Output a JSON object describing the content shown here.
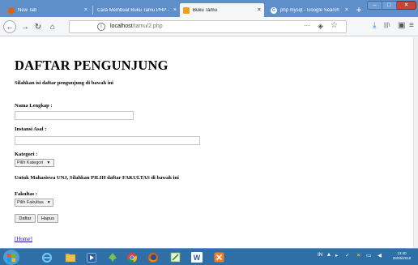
{
  "browser": {
    "tabs": [
      {
        "label": "New Tab",
        "icon": "firefox-icon",
        "color": "#e66000"
      },
      {
        "label": "Cara Membuat Buku Tamu PHP - S",
        "icon": "page-icon",
        "color": "#ffffff"
      },
      {
        "label": "Buku Tamu",
        "icon": "buku-tamu-icon",
        "color": "#f0a020"
      },
      {
        "label": "php mysql - Google Search",
        "icon": "google-icon",
        "color": "#ffffff"
      }
    ],
    "close_glyph": "×",
    "new_tab_glyph": "+",
    "window_controls": {
      "minimize": "–",
      "maximize": "□",
      "close": "×"
    },
    "nav": {
      "back": "←",
      "forward": "→",
      "reload": "↻",
      "home": "⌂"
    },
    "url": {
      "host": "localhost",
      "path": "/tamu/2.php",
      "info": "i"
    },
    "url_actions": {
      "more": "···",
      "pocket": "◈",
      "bookmark": "☆"
    },
    "toolbar": {
      "download": "⤓",
      "library": "|||\\",
      "sidebar": "▣",
      "menu": "≡"
    }
  },
  "page": {
    "title": "DAFTAR PENGUNJUNG",
    "subtitle": "Silahkan isi daftar pengunjung di bawah ini",
    "nama_label": "Nama Lengkap :",
    "instansi_label": "Instansi Asal :",
    "kategori_label": "Kategori :",
    "kategori_select": "Pilih Kategori",
    "unj_note": "Untuk Mahasiswa UNJ, Silahkan PILIH daftar FAKULTAS di bawah ini",
    "fakultas_label": "Fakultas :",
    "fakultas_select": "Pilih Fakultas",
    "daftar_button": "Daftar",
    "hapus_button": "Hapus",
    "home_link": "[Home]",
    "select_caret": "▼"
  },
  "taskbar": {
    "clock_time": "13:40",
    "clock_date": "28/05/2018",
    "tray_text": "IN"
  }
}
